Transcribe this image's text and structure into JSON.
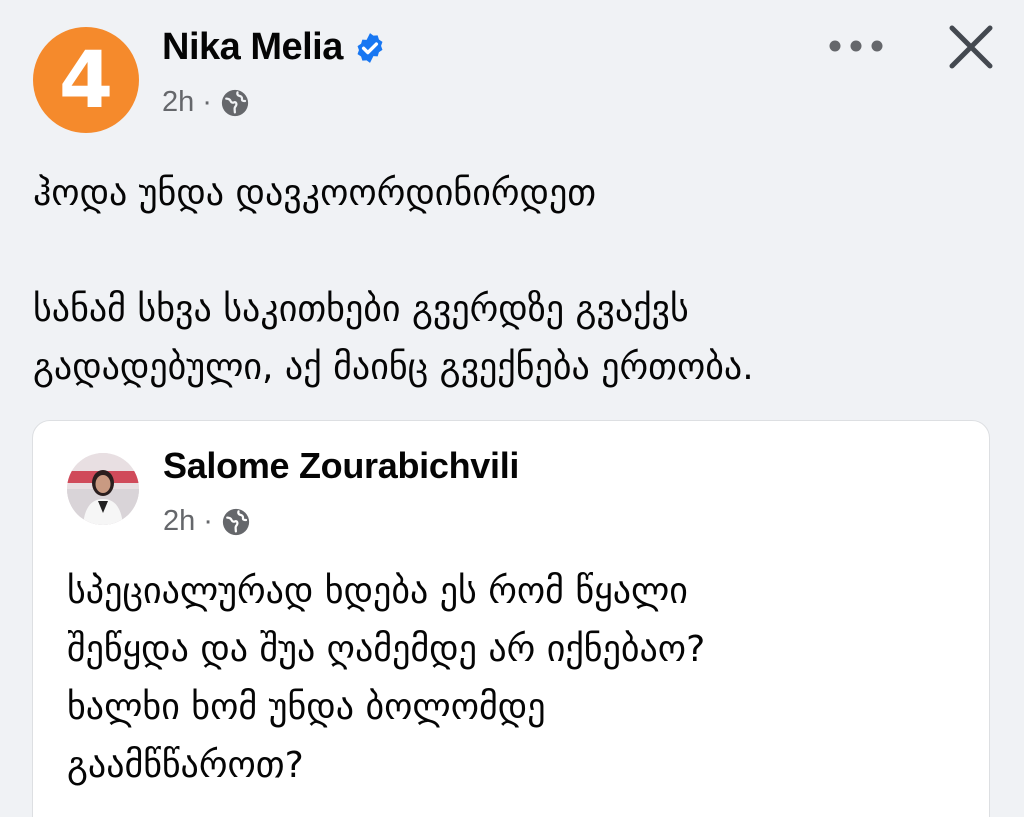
{
  "post": {
    "author": {
      "avatar_text": "4",
      "name": "Nika Melia",
      "verified": true,
      "time": "2h",
      "separator": "·",
      "audience_icon": "globe-icon"
    },
    "actions": {
      "more_icon": "more-options-icon",
      "close_icon": "close-icon"
    },
    "text": {
      "line1": "ჰოდა უნდა დავკოორდინირდეთ",
      "line2": "სანამ სხვა საკითხები გვერდზე გვაქვს",
      "line3": "გადადებული, აქ მაინც გვექნება ერთობა."
    },
    "shared": {
      "author_name": "Salome Zourabichvili",
      "time": "2h",
      "separator": "·",
      "audience_icon": "globe-icon",
      "text": {
        "line1": "სპეციალურად ხდება ეს რომ წყალი",
        "line2": "შეწყდა და შუა ღამემდე არ იქნებაო?",
        "line3": "ხალხი ხომ უნდა ბოლომდე",
        "line4": "გაამწწაროთ?"
      }
    }
  },
  "colors": {
    "background": "#f0f2f5",
    "avatar_orange": "#f58a2c",
    "verified_blue": "#1877f2",
    "meta_gray": "#65676b",
    "card_border": "#dddfe2"
  }
}
